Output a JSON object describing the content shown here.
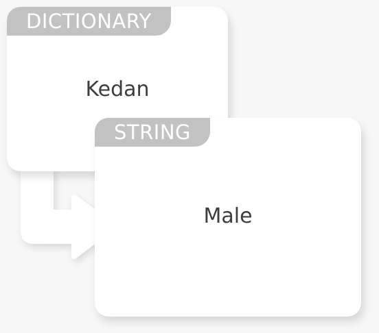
{
  "source_card": {
    "type_label": "DICTIONARY",
    "value": "Kedan"
  },
  "target_card": {
    "type_label": "STRING",
    "value": "Male"
  },
  "connector": {
    "icon": "bent-arrow-icon",
    "color": "#ffffff"
  },
  "colors": {
    "background": "#f7f7f7",
    "card": "#ffffff",
    "tag": "#c2c2c2",
    "text": "#3d3d3d"
  }
}
